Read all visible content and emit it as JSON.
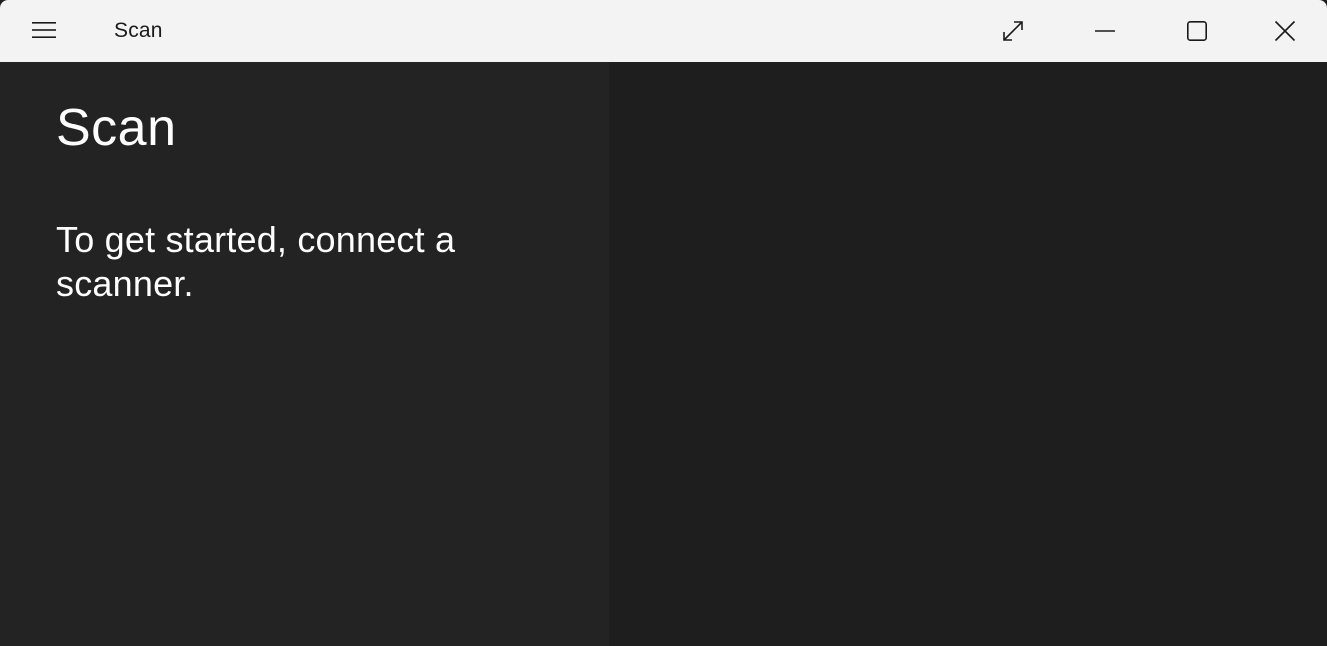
{
  "titlebar": {
    "app_title": "Scan",
    "menu_icon": "hamburger-menu-icon",
    "fullscreen_icon": "full-screen-icon",
    "minimize_icon": "minimize-icon",
    "maximize_icon": "maximize-icon",
    "close_icon": "close-icon"
  },
  "main": {
    "heading": "Scan",
    "message": "To get started, connect a scanner."
  },
  "colors": {
    "titlebar_bg": "#f3f3f3",
    "left_pane_bg": "#232323",
    "right_pane_bg": "#1e1e1e",
    "text_primary": "#ffffff"
  }
}
